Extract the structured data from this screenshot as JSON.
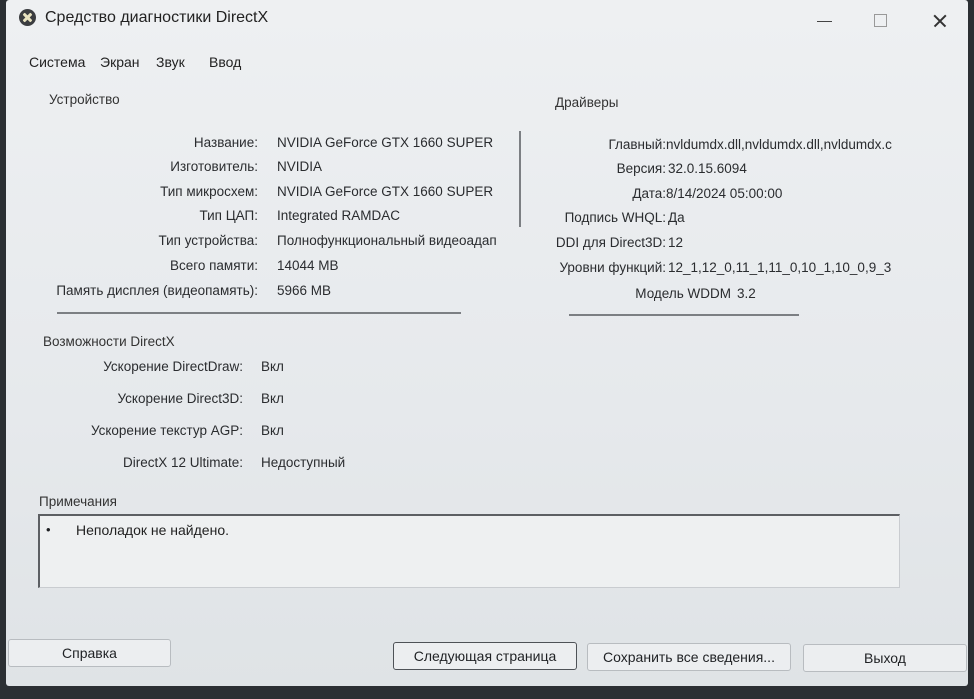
{
  "window": {
    "title": "Средство диагностики DirectX"
  },
  "tabs": [
    "Система",
    "Экран",
    "Звук",
    "Ввод"
  ],
  "device": {
    "heading": "Устройство",
    "rows": [
      {
        "label": "Название:",
        "value": "NVIDIA GeForce GTX 1660 SUPER"
      },
      {
        "label": "Изготовитель:",
        "value": "NVIDIA"
      },
      {
        "label": "Тип микросхем:",
        "value": "NVIDIA GeForce GTX 1660 SUPER"
      },
      {
        "label": "Тип ЦАП:",
        "value": "Integrated RAMDAC"
      },
      {
        "label": "Тип устройства:",
        "value": "Полнофункциональный видеоадап"
      },
      {
        "label": "Всего памяти:",
        "value": "14044 MB"
      },
      {
        "label": "Память дисплея (видеопамять):",
        "value": "5966 MB"
      }
    ]
  },
  "drivers": {
    "heading": "Драйверы",
    "rows": [
      {
        "label": "Главный:",
        "value": "nvldumdx.dll,nvldumdx.dll,nvldumdx.c"
      },
      {
        "label": "Версия:",
        "value": "32.0.15.6094"
      },
      {
        "label": "Дата:",
        "value": "8/14/2024 05:00:00"
      },
      {
        "label": "Подпись WHQL:",
        "value": "Да"
      },
      {
        "label": "DDI для Direct3D:",
        "value": "12"
      },
      {
        "label": "Уровни функций:",
        "value": "12_1,12_0,11_1,11_0,10_1,10_0,9_3"
      },
      {
        "label": "Модель WDDM",
        "value": "3.2"
      }
    ]
  },
  "directx": {
    "heading": "Возможности DirectX",
    "rows": [
      {
        "label": "Ускорение DirectDraw:",
        "value": "Вкл"
      },
      {
        "label": "Ускорение Direct3D:",
        "value": "Вкл"
      },
      {
        "label": "Ускорение текстур AGP:",
        "value": "Вкл"
      },
      {
        "label": "DirectX 12 Ultimate:",
        "value": "Недоступный"
      }
    ]
  },
  "notes": {
    "heading": "Примечания",
    "items": [
      "Неполадок не найдено."
    ]
  },
  "buttons": {
    "help": "Справка",
    "next_page": "Следующая страница",
    "save_all": "Сохранить все сведения...",
    "exit": "Выход"
  }
}
